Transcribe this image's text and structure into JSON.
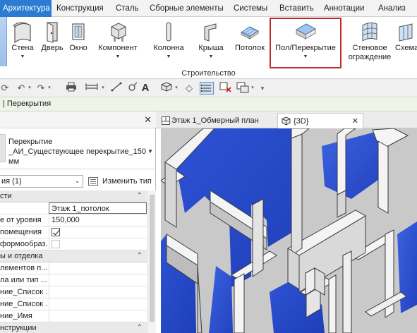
{
  "ribbon_tabs": [
    "Архитектура",
    "Конструкция",
    "Сталь",
    "Сборные элементы",
    "Системы",
    "Вставить",
    "Аннотации",
    "Анализ"
  ],
  "ribbon_buttons": {
    "wall": "Стена",
    "door": "Дверь",
    "window": "Окно",
    "component": "Компонент",
    "column": "Колонна",
    "roof": "Крыша",
    "ceiling": "Потолок",
    "floor": "Пол/Перекрытие",
    "curtain_wall_line1": "Стеновое",
    "curtain_wall_line2": "ограждение",
    "curtain_system": "Схема"
  },
  "ribbon_group_label": "Строительство",
  "context_bar": "| Перекрытия",
  "properties": {
    "type_line1": "Перекрытие",
    "type_line2": "_АИ_Существующее перекрытие_150",
    "type_line3": "мм",
    "filter": "ия (1)",
    "edit_type": "Изменить тип",
    "rows": [
      {
        "kind": "cat",
        "label": "сти"
      },
      {
        "kind": "input",
        "label": "",
        "value": "Этаж 1_потолок"
      },
      {
        "kind": "value",
        "label": "е от уровня",
        "value": "150,000"
      },
      {
        "kind": "check",
        "label": "помещения",
        "checked": true
      },
      {
        "kind": "check-dis",
        "label": "формообраз...",
        "checked": false
      },
      {
        "kind": "cat",
        "label": "ы и отделка"
      },
      {
        "kind": "value",
        "label": "лементов п...",
        "value": ""
      },
      {
        "kind": "value",
        "label": "ла или тип ...",
        "value": ""
      },
      {
        "kind": "value",
        "label": "ние_Список ...",
        "value": ""
      },
      {
        "kind": "value",
        "label": "ние_Список ...",
        "value": ""
      },
      {
        "kind": "value",
        "label": "ние_Имя",
        "value": ""
      },
      {
        "kind": "cat",
        "label": "нструкции"
      }
    ]
  },
  "view_tabs": {
    "plan": "Этаж 1_Обмерный план",
    "view3d": "{3D}",
    "close": "✕"
  },
  "icons": {
    "close": "close-icon",
    "dropdown": "chevron-down-icon"
  },
  "colors": {
    "accent": "#2b7bd2",
    "highlight": "#c12a2a",
    "floor_blue": "#2f5bd6"
  }
}
